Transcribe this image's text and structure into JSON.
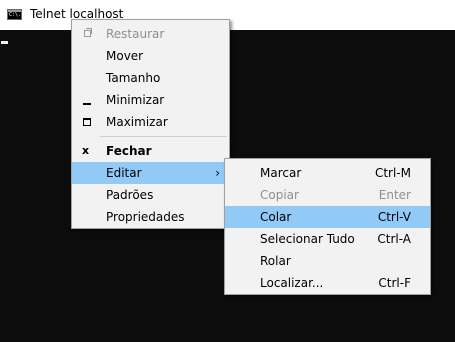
{
  "window": {
    "title": "Telnet localhost",
    "icon": "console-app-icon",
    "icon_glyph": "C:\\."
  },
  "system_menu": {
    "items": [
      {
        "label": "Restaurar",
        "icon": "restore-icon",
        "enabled": false
      },
      {
        "label": "Mover",
        "enabled": true
      },
      {
        "label": "Tamanho",
        "enabled": true
      },
      {
        "label": "Minimizar",
        "icon": "minimize-icon",
        "enabled": true
      },
      {
        "label": "Maximizar",
        "icon": "maximize-icon",
        "enabled": true
      },
      {
        "label": "Fechar",
        "icon": "close-icon",
        "icon_glyph": "x",
        "enabled": true,
        "bold": true
      },
      {
        "label": "Editar",
        "enabled": true,
        "highlighted": true,
        "has_submenu": true,
        "arrow": "›"
      },
      {
        "label": "Padrões",
        "enabled": true
      },
      {
        "label": "Propriedades",
        "enabled": true
      }
    ]
  },
  "edit_submenu": {
    "items": [
      {
        "label": "Marcar",
        "shortcut": "Ctrl-M",
        "enabled": true
      },
      {
        "label": "Copiar",
        "shortcut": "Enter",
        "enabled": false
      },
      {
        "label": "Colar",
        "shortcut": "Ctrl-V",
        "enabled": true,
        "highlighted": true
      },
      {
        "label": "Selecionar Tudo",
        "shortcut": "Ctrl-A",
        "enabled": true
      },
      {
        "label": "Rolar",
        "shortcut": "",
        "enabled": true
      },
      {
        "label": "Localizar...",
        "shortcut": "Ctrl-F",
        "enabled": true
      }
    ]
  },
  "colors": {
    "console_bg": "#0c0c0c",
    "menu_bg": "#f2f2f2",
    "highlight": "#91c9f7",
    "disabled_text": "#8f8f8f"
  }
}
